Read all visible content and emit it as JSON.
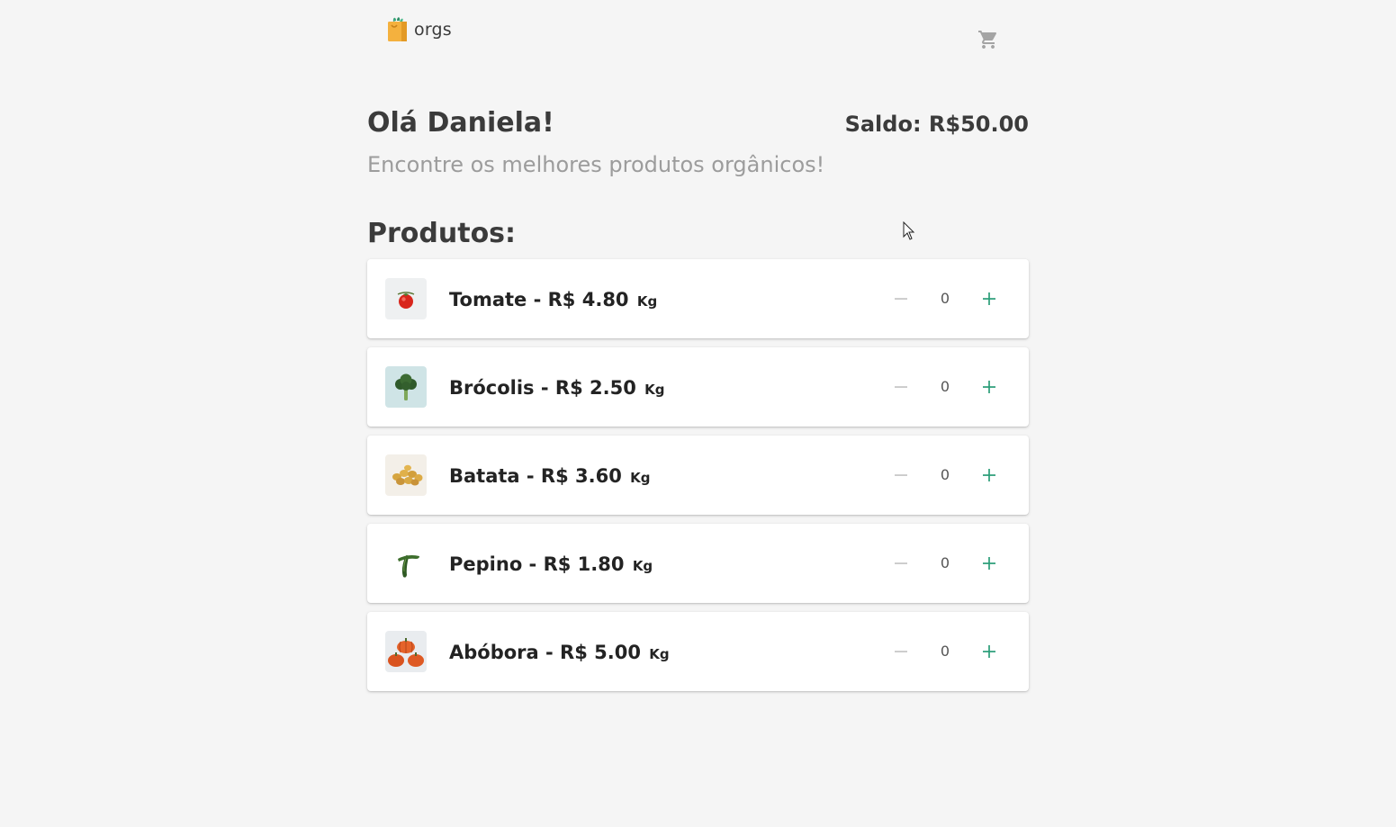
{
  "header": {
    "logo_text": "orgs",
    "cart_icon": "shopping-cart-icon"
  },
  "user": {
    "greeting": "Olá Daniela!",
    "balance": "Saldo: R$50.00"
  },
  "subtitle": "Encontre os melhores produtos orgânicos!",
  "products_title": "Produtos:",
  "products": [
    {
      "label": "Tomate - R$ 4.80",
      "unit": "Kg",
      "quantity": "0",
      "icon": "tomato-image"
    },
    {
      "label": "Brócolis - R$ 2.50",
      "unit": "Kg",
      "quantity": "0",
      "icon": "broccoli-image"
    },
    {
      "label": "Batata - R$ 3.60",
      "unit": "Kg",
      "quantity": "0",
      "icon": "potato-image"
    },
    {
      "label": "Pepino - R$ 1.80",
      "unit": "Kg",
      "quantity": "0",
      "icon": "cucumber-image"
    },
    {
      "label": "Abóbora - R$ 5.00",
      "unit": "Kg",
      "quantity": "0",
      "icon": "pumpkin-image"
    }
  ],
  "colors": {
    "accent": "#2a9d78",
    "muted": "#bdbdbd",
    "text": "#3b3b3b",
    "subtitle": "#9c9c9c",
    "background": "#f5f5f5"
  }
}
